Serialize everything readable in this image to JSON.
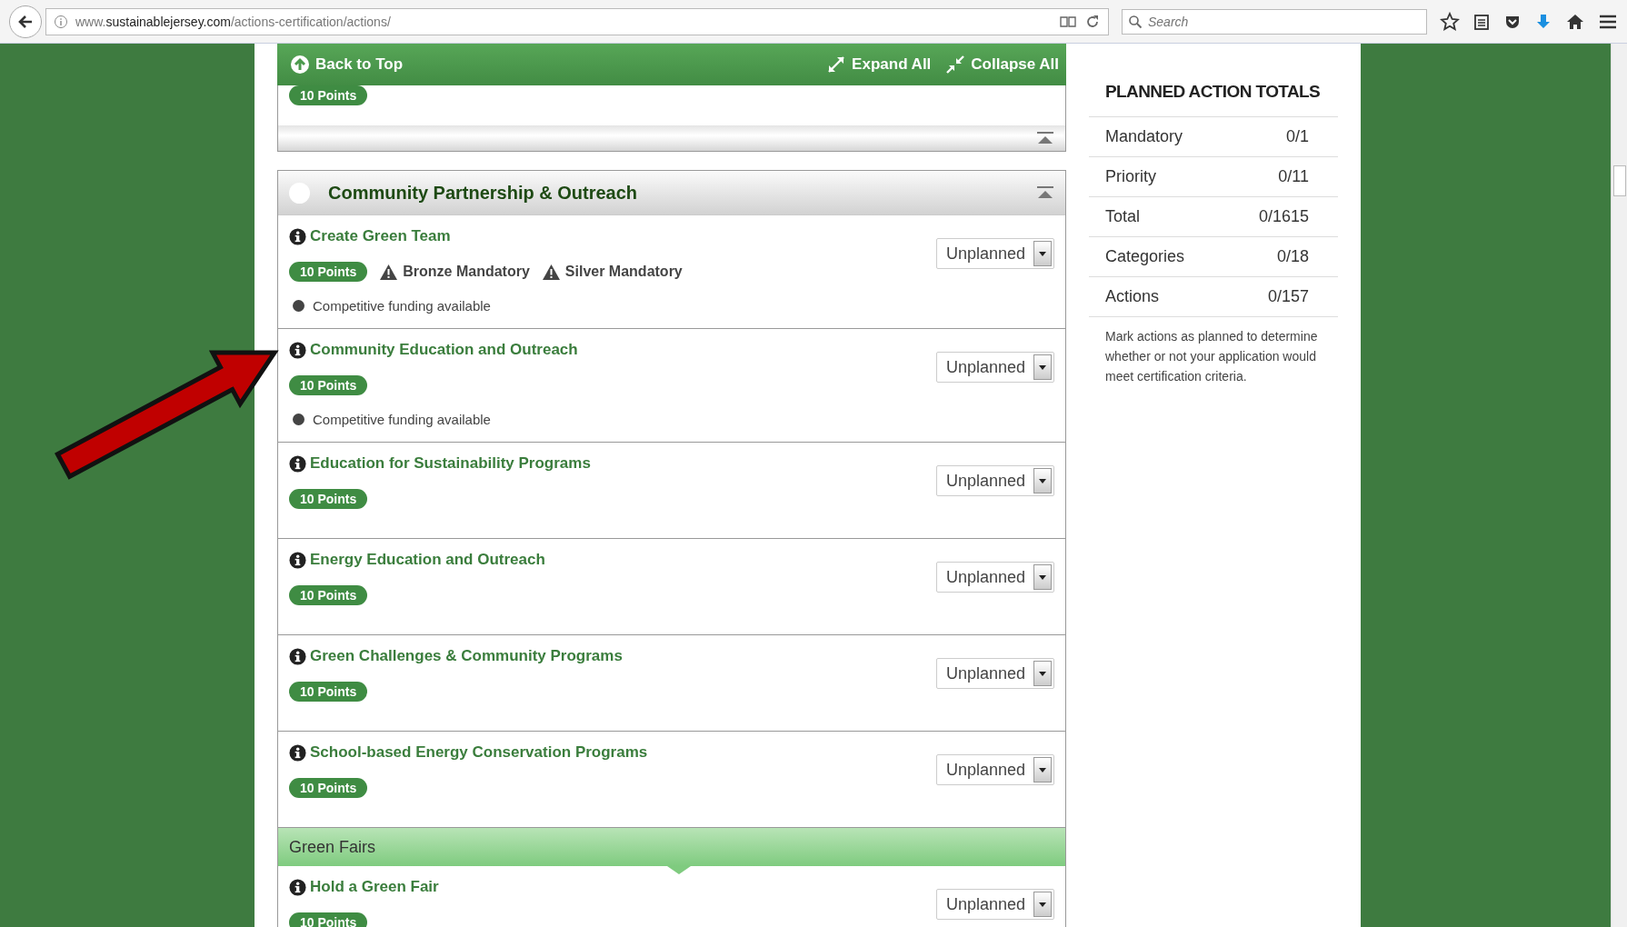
{
  "browser": {
    "url": "www.**sustainablejersey.com**/actions-certification/actions/",
    "search_placeholder": "Search"
  },
  "toolbar": {
    "back_to_top": "Back to Top",
    "expand_all": "Expand All",
    "collapse_all": "Collapse All"
  },
  "previous_section": {
    "points": "10 Points"
  },
  "section": {
    "title": "Community Partnership & Outreach",
    "expanded": true,
    "items": [
      {
        "kind": "action",
        "title": "Create Green Team",
        "points": "10 Points",
        "flags": [
          "Bronze Mandatory",
          "Silver Mandatory"
        ],
        "note": "Competitive funding available",
        "status": "Unplanned"
      },
      {
        "kind": "action",
        "title": "Community Education and Outreach",
        "points": "10 Points",
        "note": "Competitive funding available",
        "status": "Unplanned"
      },
      {
        "kind": "action",
        "title": "Education for Sustainability Programs",
        "points": "10 Points",
        "status": "Unplanned"
      },
      {
        "kind": "action",
        "title": "Energy Education and Outreach",
        "points": "10 Points",
        "status": "Unplanned"
      },
      {
        "kind": "action",
        "title": "Green Challenges & Community Programs",
        "points": "10 Points",
        "status": "Unplanned"
      },
      {
        "kind": "action",
        "title": "School-based Energy Conservation Programs",
        "points": "10 Points",
        "status": "Unplanned"
      },
      {
        "kind": "subheader",
        "title": "Green Fairs"
      },
      {
        "kind": "action",
        "title": "Hold a Green Fair",
        "points": "10 Points",
        "status": "Unplanned"
      }
    ]
  },
  "totals": {
    "title": "PLANNED ACTION TOTALS",
    "rows": [
      {
        "label": "Mandatory",
        "value": "0/1"
      },
      {
        "label": "Priority",
        "value": "0/11"
      },
      {
        "label": "Total",
        "value": "0/1615"
      },
      {
        "label": "Categories",
        "value": "0/18"
      },
      {
        "label": "Actions",
        "value": "0/157"
      }
    ],
    "note": "Mark actions as planned to determine whether or not your application would meet certification criteria."
  }
}
